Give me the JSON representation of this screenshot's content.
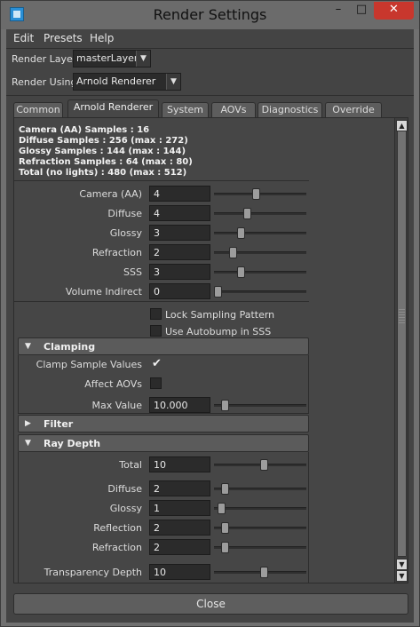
{
  "window": {
    "title": "Render Settings",
    "controls": {
      "minimize": "–",
      "maximize": "□",
      "close": "✕"
    }
  },
  "menu": [
    "Edit",
    "Presets",
    "Help"
  ],
  "render_layer": {
    "label": "Render Layer",
    "value": "masterLayer"
  },
  "render_using": {
    "label": "Render Using",
    "value": "Arnold Renderer"
  },
  "tabs": [
    {
      "label": "Common",
      "active": false
    },
    {
      "label": "Arnold Renderer",
      "active": true
    },
    {
      "label": "System",
      "active": false
    },
    {
      "label": "AOVs",
      "active": false
    },
    {
      "label": "Diagnostics",
      "active": false
    },
    {
      "label": "Override",
      "active": false
    }
  ],
  "stats": [
    "Camera (AA) Samples : 16",
    "Diffuse Samples : 256 (max : 272)",
    "Glossy Samples : 144 (max : 144)",
    "Refraction Samples : 64 (max : 80)",
    "Total (no lights) : 480 (max : 512)"
  ],
  "sampling": [
    {
      "label": "Camera (AA)",
      "value": "4",
      "slider": 0.45
    },
    {
      "label": "Diffuse",
      "value": "4",
      "slider": 0.35
    },
    {
      "label": "Glossy",
      "value": "3",
      "slider": 0.27
    },
    {
      "label": "Refraction",
      "value": "2",
      "slider": 0.18
    },
    {
      "label": "SSS",
      "value": "3",
      "slider": 0.27
    },
    {
      "label": "Volume Indirect",
      "value": "0",
      "slider": 0.0
    }
  ],
  "checkboxes": [
    {
      "label": "Lock Sampling Pattern",
      "checked": false
    },
    {
      "label": "Use Autobump in SSS",
      "checked": false
    }
  ],
  "clamping": {
    "title": "Clamping",
    "clamp_sample_values": {
      "label": "Clamp Sample Values",
      "checked": true
    },
    "affect_aovs": {
      "label": "Affect AOVs",
      "checked": false
    },
    "max_value": {
      "label": "Max Value",
      "value": "10.000",
      "slider": 0.08
    }
  },
  "filter": {
    "title": "Filter"
  },
  "ray_depth": {
    "title": "Ray Depth",
    "rows": [
      {
        "label": "Total",
        "value": "10",
        "slider": 0.55
      },
      {
        "label": "Diffuse",
        "value": "2",
        "slider": 0.08
      },
      {
        "label": "Glossy",
        "value": "1",
        "slider": 0.04
      },
      {
        "label": "Reflection",
        "value": "2",
        "slider": 0.08
      },
      {
        "label": "Refraction",
        "value": "2",
        "slider": 0.08
      },
      {
        "label": "Transparency Depth",
        "value": "10",
        "slider": 0.55
      }
    ]
  },
  "close_button": "Close"
}
